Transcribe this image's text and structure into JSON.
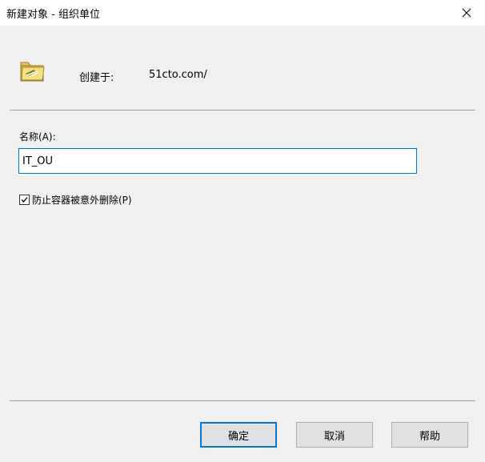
{
  "window": {
    "title": "新建对象 - 组织单位",
    "close_icon": "close-icon"
  },
  "header": {
    "icon": "folder-icon",
    "created_label": "创建于:",
    "created_value": "51cto.com/"
  },
  "form": {
    "name_label": "名称(A):",
    "name_value": "IT_OU",
    "protect_checkbox": {
      "label": "防止容器被意外删除(P)",
      "checked": true
    }
  },
  "buttons": {
    "ok": "确定",
    "cancel": "取消",
    "help": "帮助"
  },
  "colors": {
    "accent": "#0078d7",
    "dialog_bg": "#f0f0f0"
  }
}
